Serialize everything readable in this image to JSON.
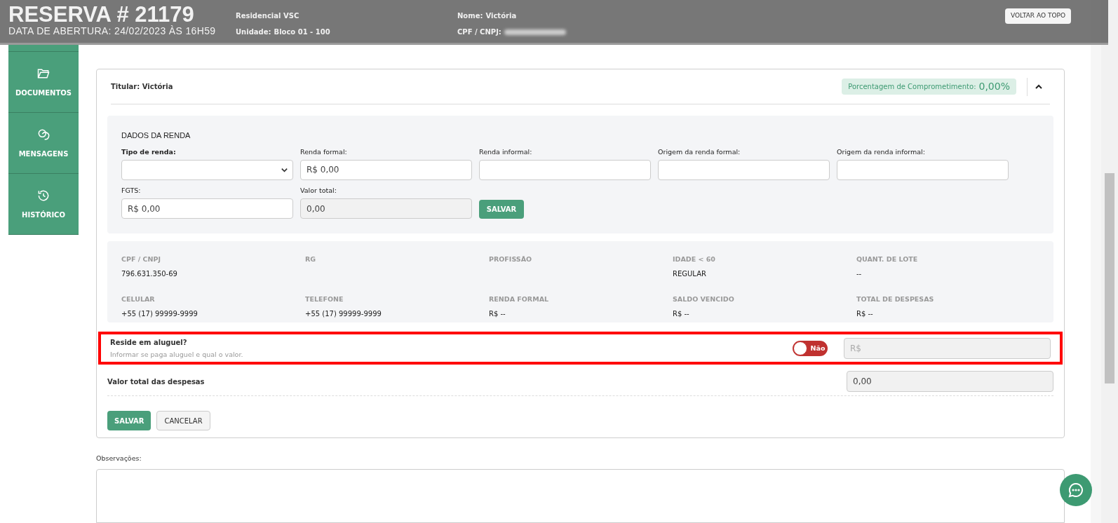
{
  "header": {
    "title": "RESERVA # 21179",
    "subtitle": "DATA DE ABERTURA: 24/02/2023 ÀS 16H59",
    "columns": [
      [
        {
          "value": "Residencial VSC"
        },
        {
          "label": "Unidade:",
          "value": "Bloco 01 - 100"
        }
      ],
      [
        {
          "label": "Nome:",
          "value": "Victória"
        },
        {
          "label": "CPF / CNPJ:",
          "redacted": true
        }
      ]
    ],
    "back_to_top": "VOLTAR AO TOPO"
  },
  "sidebar": {
    "items": [
      {
        "label": "DOCUMENTOS"
      },
      {
        "label": "MENSAGENS"
      },
      {
        "label": "HISTÓRICO"
      }
    ]
  },
  "card": {
    "titular": {
      "label": "Titular:",
      "value": "Victória"
    },
    "commitment": {
      "label": "Porcentagem de Comprometimento:",
      "value": "0,00%"
    },
    "expanded": true,
    "income": {
      "title": "DADOS DA RENDA",
      "fields": [
        {
          "kind": "select",
          "label": "Tipo de renda:"
        },
        {
          "kind": "input",
          "label": "Renda formal:",
          "value": "R$ 0,00"
        },
        {
          "kind": "input",
          "label": "Renda informal:"
        },
        {
          "kind": "input",
          "label": "Origem da renda formal:"
        },
        {
          "kind": "input",
          "label": "Origem da renda informal:"
        },
        {
          "kind": "input",
          "label": "FGTS:",
          "value": "R$ 0,00"
        },
        {
          "kind": "readonly",
          "label": "Valor total:",
          "value": "0,00"
        }
      ],
      "save": "SALVAR"
    },
    "info": [
      {
        "label": "CPF / CNPJ",
        "value": "796.631.350-69"
      },
      {
        "label": "RG"
      },
      {
        "label": "PROFISSÃO"
      },
      {
        "label": "IDADE < 60",
        "value": "REGULAR"
      },
      {
        "label": "QUANT. DE LOTE",
        "value": "--"
      },
      {
        "label": "CELULAR",
        "value": "+55 (17) 99999-9999"
      },
      {
        "label": "TELEFONE",
        "value": "+55 (17) 99999-9999"
      },
      {
        "label": "RENDA FORMAL",
        "value": "R$ --"
      },
      {
        "label": "SALDO VENCIDO",
        "value": "R$ --"
      },
      {
        "label": "TOTAL DE DESPESAS",
        "value": "R$ --"
      }
    ],
    "rent": {
      "title": "Reside em aluguel?",
      "hint": "Informar se paga aluguel e qual o valor.",
      "highlighted": true,
      "toggle": {
        "on": false,
        "label": "Não"
      },
      "amount": {
        "placeholder": "R$",
        "disabled": true
      }
    },
    "total_expenses": {
      "label": "Valor total das despesas",
      "value": "0,00"
    },
    "buttons": [
      {
        "kind": "primary",
        "label": "SALVAR"
      },
      {
        "kind": "secondary",
        "label": "CANCELAR"
      }
    ]
  },
  "notes": {
    "label": "Observações:"
  }
}
